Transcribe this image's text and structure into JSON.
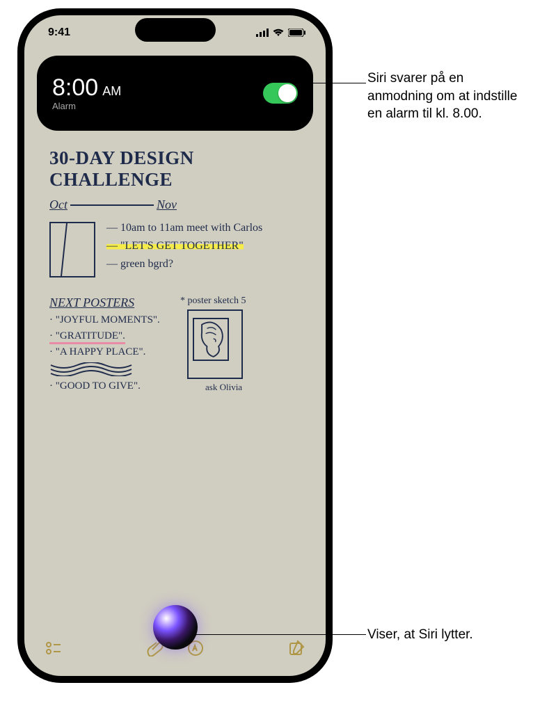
{
  "status_bar": {
    "time": "9:41"
  },
  "alarm": {
    "time": "8:00",
    "ampm": "AM",
    "label": "Alarm"
  },
  "note": {
    "title_l1": "30-DAY DESIGN",
    "title_l2": "CHALLENGE",
    "month_oct": "Oct",
    "month_nov": "Nov",
    "line1": "— 10am to 11am meet with Carlos",
    "line2": "— \"LET'S GET TOGETHER\"",
    "line3": "— green bgrd?",
    "next_posters": "NEXT POSTERS",
    "np1": "· \"JOYFUL MOMENTS\".",
    "np2": "· \"GRATITUDE\".",
    "np3": "· \"A HAPPY PLACE\".",
    "np4": "· \"GOOD TO GIVE\".",
    "sketch_label": "* poster sketch 5",
    "ask_olivia": "ask Olivia"
  },
  "callouts": {
    "c1": "Siri svarer på en anmodning om at indstille en alarm til kl. 8.00.",
    "c2": "Viser, at Siri lytter."
  }
}
